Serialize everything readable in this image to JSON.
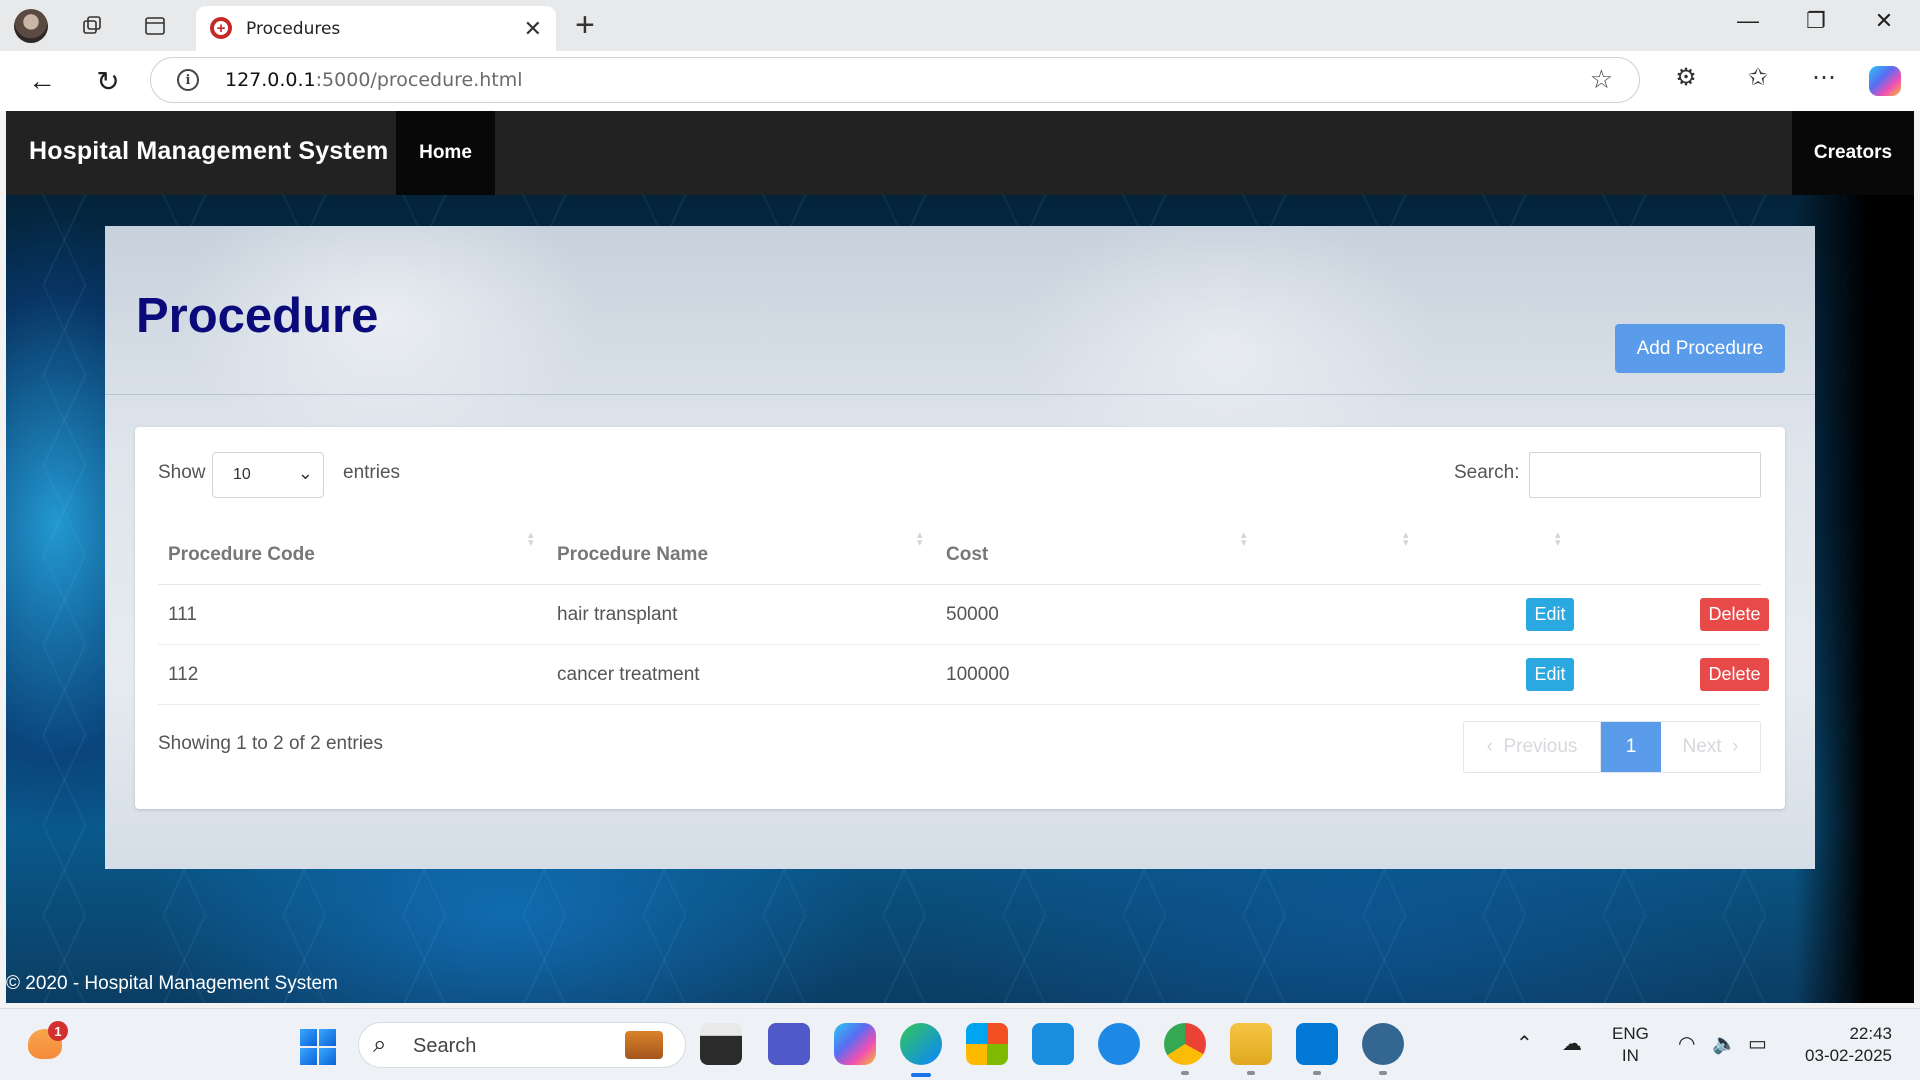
{
  "browser": {
    "tab_title": "Procedures",
    "url_host": "127.0.0.1",
    "url_rest": ":5000/procedure.html"
  },
  "navbar": {
    "brand": "Hospital Management System",
    "home": "Home",
    "creators": "Creators"
  },
  "page": {
    "title": "Procedure",
    "add_button": "Add Procedure"
  },
  "table": {
    "show_label": "Show",
    "length_value": "10",
    "entries_label": "entries",
    "search_label": "Search:",
    "columns": [
      "Procedure Code",
      "Procedure Name",
      "Cost"
    ],
    "rows": [
      {
        "code": "111",
        "name": "hair transplant",
        "cost": "50000",
        "edit": "Edit",
        "delete": "Delete"
      },
      {
        "code": "112",
        "name": "cancer treatment",
        "cost": "100000",
        "edit": "Edit",
        "delete": "Delete"
      }
    ],
    "info": "Showing 1 to 2 of 2 entries",
    "pagination": {
      "previous": "Previous",
      "current": "1",
      "next": "Next"
    }
  },
  "footer": "© 2020 - Hospital Management System",
  "taskbar": {
    "search_placeholder": "Search",
    "notification_count": "1",
    "lang_top": "ENG",
    "lang_bottom": "IN",
    "time": "22:43",
    "date": "03-02-2025"
  },
  "colors": {
    "navbar": "#222222",
    "title": "#0a0a7a",
    "primary": "#5a9bea",
    "edit": "#29a9e0",
    "delete": "#e84a4a"
  }
}
